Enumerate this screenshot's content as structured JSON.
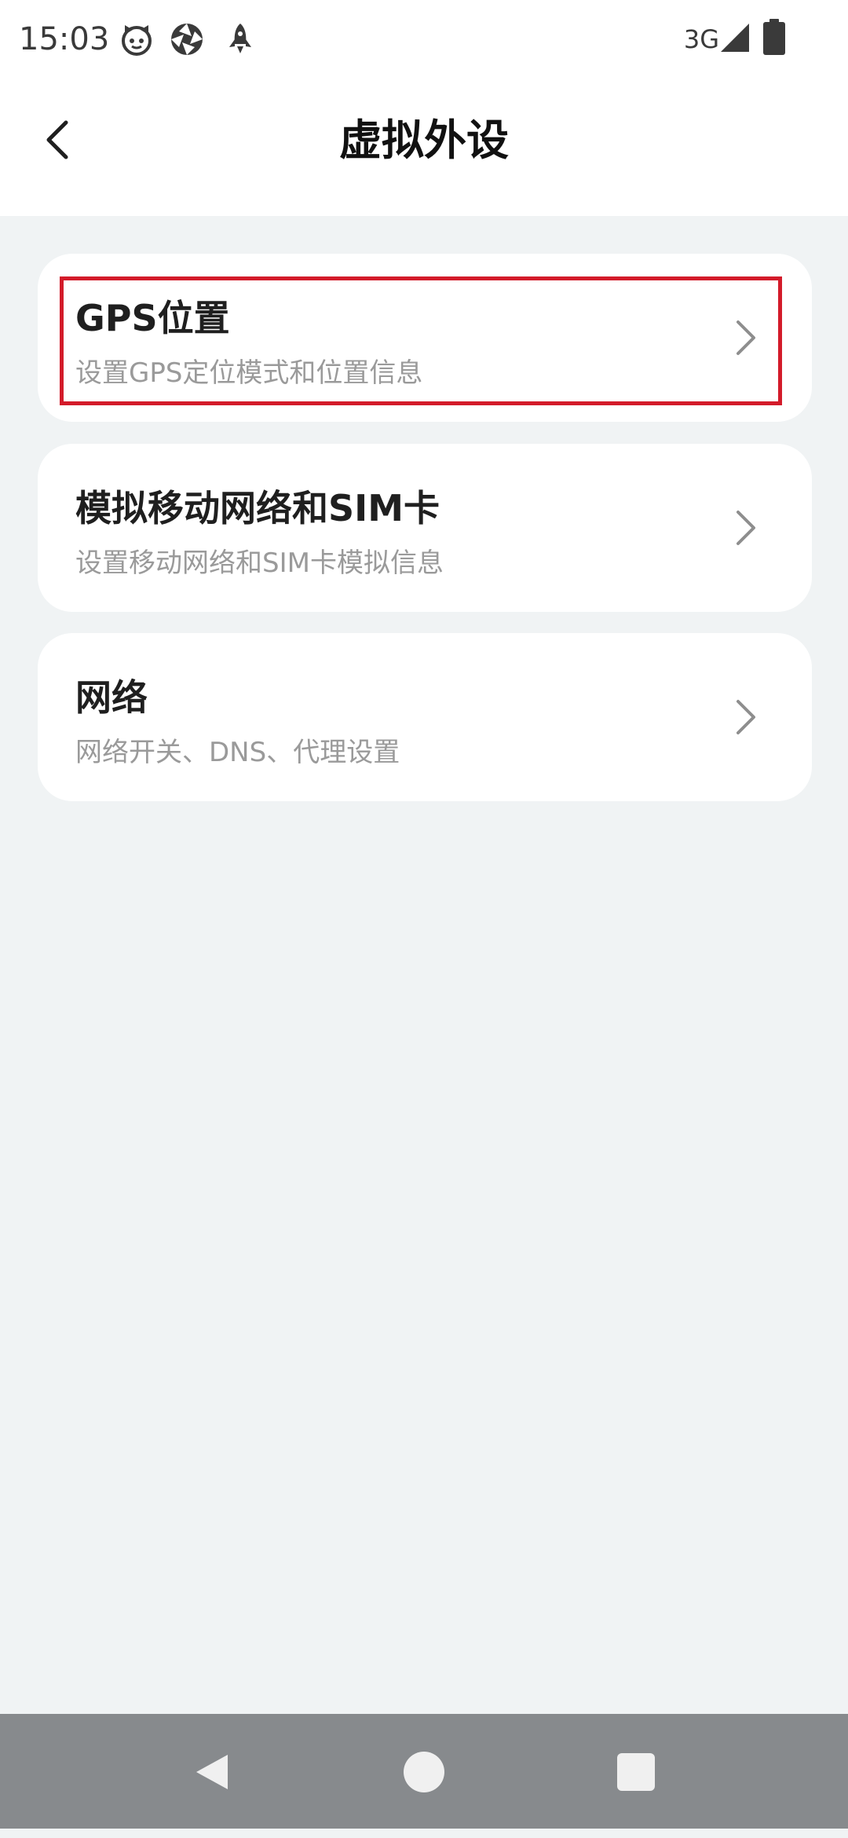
{
  "status_bar": {
    "time": "15:03",
    "network_type": "3G",
    "icons": [
      "cat-face-icon",
      "aperture-icon",
      "rocket-icon",
      "signal-icon",
      "battery-icon"
    ]
  },
  "app_bar": {
    "title": "虚拟外设",
    "back_icon": "chevron-left-icon"
  },
  "settings_items": [
    {
      "title": "GPS位置",
      "subtitle": "设置GPS定位模式和位置信息",
      "highlighted": true
    },
    {
      "title": "模拟移动网络和SIM卡",
      "subtitle": "设置移动网络和SIM卡模拟信息",
      "highlighted": false
    },
    {
      "title": "网络",
      "subtitle": "网络开关、DNS、代理设置",
      "highlighted": false
    }
  ],
  "nav_bar": {
    "buttons": [
      "back-triangle-icon",
      "home-circle-icon",
      "recents-square-icon"
    ]
  },
  "colors": {
    "background": "#F0F3F4",
    "card": "#FFFFFF",
    "highlight": "#D31B2A",
    "subtitle": "#9A9A9A",
    "nav_bar": "#878A8D"
  }
}
